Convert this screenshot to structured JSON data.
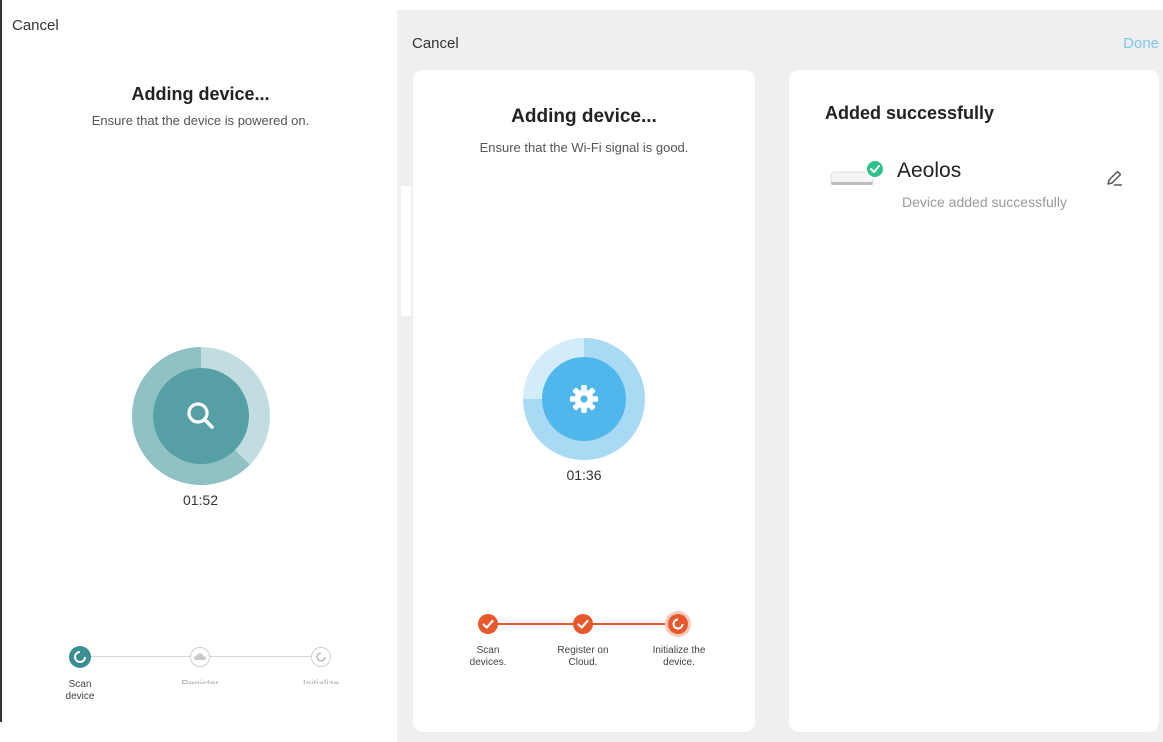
{
  "screen1": {
    "cancel_label": "Cancel",
    "title": "Adding device...",
    "subtitle": "Ensure that the device is powered on.",
    "timer": "01:52",
    "steps": [
      {
        "label": "Scan\ndevice"
      },
      {
        "label": "Register"
      },
      {
        "label": "Initialize"
      }
    ],
    "accent_color": "#3b8e92",
    "icon": "search-icon"
  },
  "screen2": {
    "cancel_label": "Cancel",
    "title": "Adding device...",
    "subtitle": "Ensure that the Wi-Fi signal is good.",
    "timer": "01:36",
    "steps": [
      {
        "label": "Scan\ndevices."
      },
      {
        "label": "Register on\nCloud."
      },
      {
        "label": "Initialize the\ndevice."
      }
    ],
    "accent_color": "#e8582d",
    "icon": "gear-icon"
  },
  "screen3": {
    "done_label": "Done",
    "title": "Added successfully",
    "device_name": "Aeolos",
    "device_status": "Device added successfully",
    "success_color": "#2ec38b",
    "icon": "edit-icon"
  }
}
